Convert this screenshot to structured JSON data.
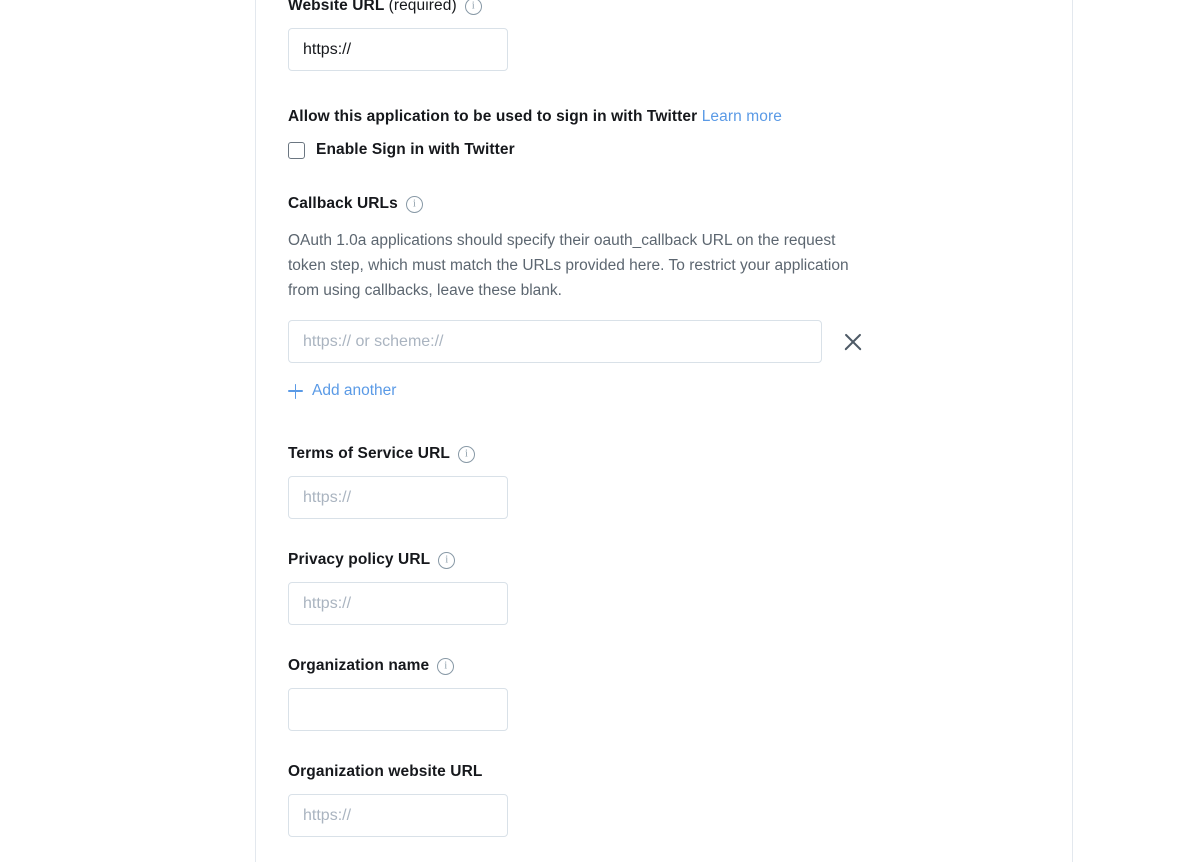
{
  "form": {
    "website": {
      "label": "Website URL",
      "required_suffix": "(required)",
      "info_icon": "info-icon",
      "value": "https://"
    },
    "signin": {
      "heading": "Allow this application to be used to sign in with Twitter",
      "learn_more": "Learn more",
      "checkbox_label": "Enable Sign in with Twitter",
      "checked": false
    },
    "callback": {
      "label": "Callback URLs",
      "info_icon": "info-icon",
      "help_text": "OAuth 1.0a applications should specify their oauth_callback URL on the request token step, which must match the URLs provided here. To restrict your application from using callbacks, leave these blank.",
      "placeholder": "https:// or scheme://",
      "value": "",
      "remove_icon": "close-icon",
      "add_another": "Add another",
      "add_icon": "plus-icon"
    },
    "terms_of_service": {
      "label": "Terms of Service URL",
      "info_icon": "info-icon",
      "placeholder": "https://",
      "value": ""
    },
    "privacy_policy": {
      "label": "Privacy policy URL",
      "info_icon": "info-icon",
      "placeholder": "https://",
      "value": ""
    },
    "organization_name": {
      "label": "Organization name",
      "info_icon": "info-icon",
      "placeholder": "",
      "value": ""
    },
    "organization_website": {
      "label": "Organization website URL",
      "placeholder": "https://",
      "value": ""
    }
  },
  "colors": {
    "link": "#5a9ae6",
    "label": "#16181c",
    "help_text": "#5c6670",
    "input_border": "#d9e1e8",
    "placeholder": "#aab4c0",
    "rule": "#e3e8ee"
  }
}
